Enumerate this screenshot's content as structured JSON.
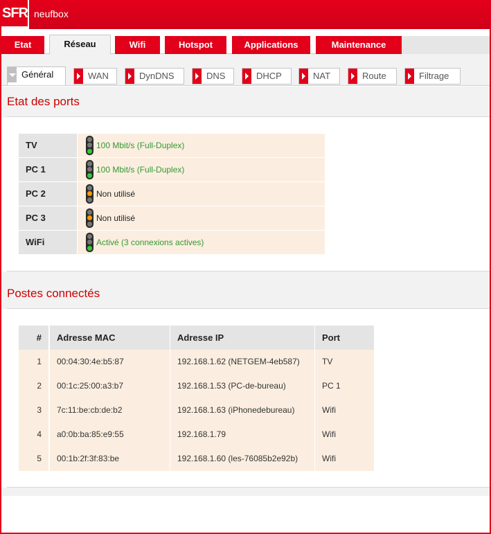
{
  "header": {
    "logo_text": "SFR",
    "brand": "neufbox"
  },
  "main_tabs": [
    "Etat",
    "Réseau",
    "Wifi",
    "Hotspot",
    "Applications",
    "Maintenance"
  ],
  "main_tab_active": "Réseau",
  "sub_tabs": [
    "Général",
    "WAN",
    "DynDNS",
    "DNS",
    "DHCP",
    "NAT",
    "Route",
    "Filtrage"
  ],
  "sub_tab_active": "Général",
  "ports": {
    "title": "Etat des ports",
    "rows": [
      {
        "name": "TV",
        "status": "100 Mbit/s (Full-Duplex)",
        "light": "green"
      },
      {
        "name": "PC 1",
        "status": "100 Mbit/s (Full-Duplex)",
        "light": "green"
      },
      {
        "name": "PC 2",
        "status": "Non utilisé",
        "light": "orange"
      },
      {
        "name": "PC 3",
        "status": "Non utilisé",
        "light": "orange"
      },
      {
        "name": "WiFi",
        "status": "Activé (3 connexions actives)",
        "light": "green"
      }
    ]
  },
  "hosts": {
    "title": "Postes connectés",
    "columns": [
      "#",
      "Adresse MAC",
      "Adresse IP",
      "Port"
    ],
    "rows": [
      [
        "1",
        "00:04:30:4e:b5:87",
        "192.168.1.62 (NETGEM-4eb587)",
        "TV"
      ],
      [
        "2",
        "00:1c:25:00:a3:b7",
        "192.168.1.53 (PC-de-bureau)",
        "PC 1"
      ],
      [
        "3",
        "7c:11:be:cb:de:b2",
        "192.168.1.63 (iPhonedebureau)",
        "Wifi"
      ],
      [
        "4",
        "a0:0b:ba:85:e9:55",
        "192.168.1.79",
        "Wifi"
      ],
      [
        "5",
        "00:1b:2f:3f:83:be",
        "192.168.1.60 (les-76085b2e92b)",
        "Wifi"
      ]
    ]
  },
  "colors": {
    "brand_red": "#e2001a",
    "section_title": "#cc0000",
    "ok_green": "#339933",
    "row_bg": "#fbeee0"
  }
}
